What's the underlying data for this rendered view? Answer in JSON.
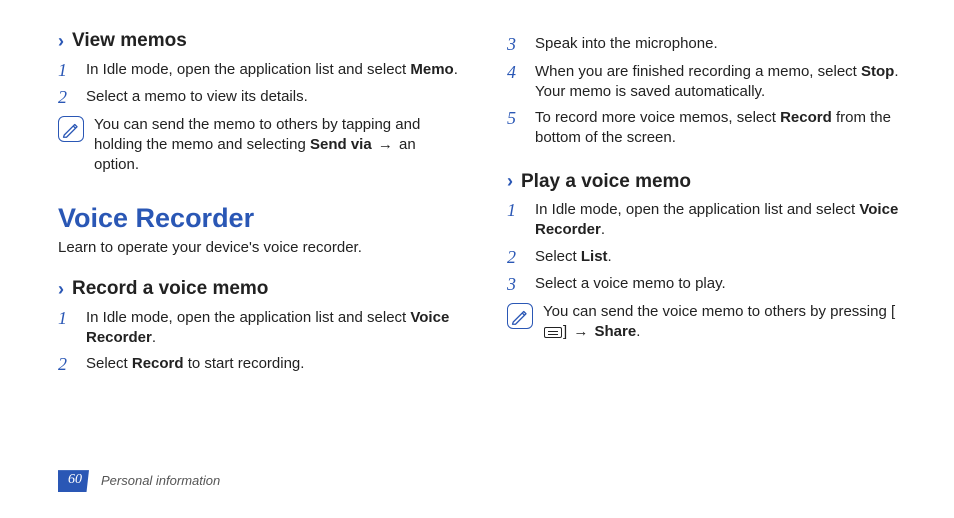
{
  "left": {
    "viewMemos": {
      "heading": "View memos",
      "steps": [
        {
          "num": "1",
          "pre": "In Idle mode, open the application list and select ",
          "bold": "Memo",
          "post": "."
        },
        {
          "num": "2",
          "text": "Select a memo to view its details."
        }
      ],
      "note": {
        "pre": "You can send the memo to others by tapping and holding the memo and selecting ",
        "bold": "Send via",
        "arrow": "→",
        "post": " an option."
      }
    },
    "voiceRecorder": {
      "title": "Voice Recorder",
      "intro": "Learn to operate your device's voice recorder."
    },
    "recordMemo": {
      "heading": "Record a voice memo",
      "steps": [
        {
          "num": "1",
          "pre": "In Idle mode, open the application list and select ",
          "bold": "Voice Recorder",
          "post": "."
        },
        {
          "num": "2",
          "pre": "Select ",
          "bold": "Record",
          "post": " to start recording."
        }
      ]
    }
  },
  "right": {
    "contSteps": [
      {
        "num": "3",
        "text": "Speak into the microphone."
      },
      {
        "num": "4",
        "pre": "When you are finished recording a memo, select ",
        "bold": "Stop",
        "post": ". Your memo is saved automatically."
      },
      {
        "num": "5",
        "pre": "To record more voice memos, select ",
        "bold": "Record",
        "post": " from the bottom of the screen."
      }
    ],
    "playMemo": {
      "heading": "Play a voice memo",
      "steps": [
        {
          "num": "1",
          "pre": "In Idle mode, open the application list and select ",
          "bold": "Voice Recorder",
          "post": "."
        },
        {
          "num": "2",
          "pre": "Select ",
          "bold": "List",
          "post": "."
        },
        {
          "num": "3",
          "text": "Select a voice memo to play."
        }
      ],
      "note": {
        "pre": "You can send the voice memo to others by pressing [",
        "post1": "] ",
        "arrow": "→",
        "post2": " ",
        "bold": "Share",
        "post3": "."
      }
    }
  },
  "footer": {
    "page": "60",
    "section": "Personal information"
  }
}
